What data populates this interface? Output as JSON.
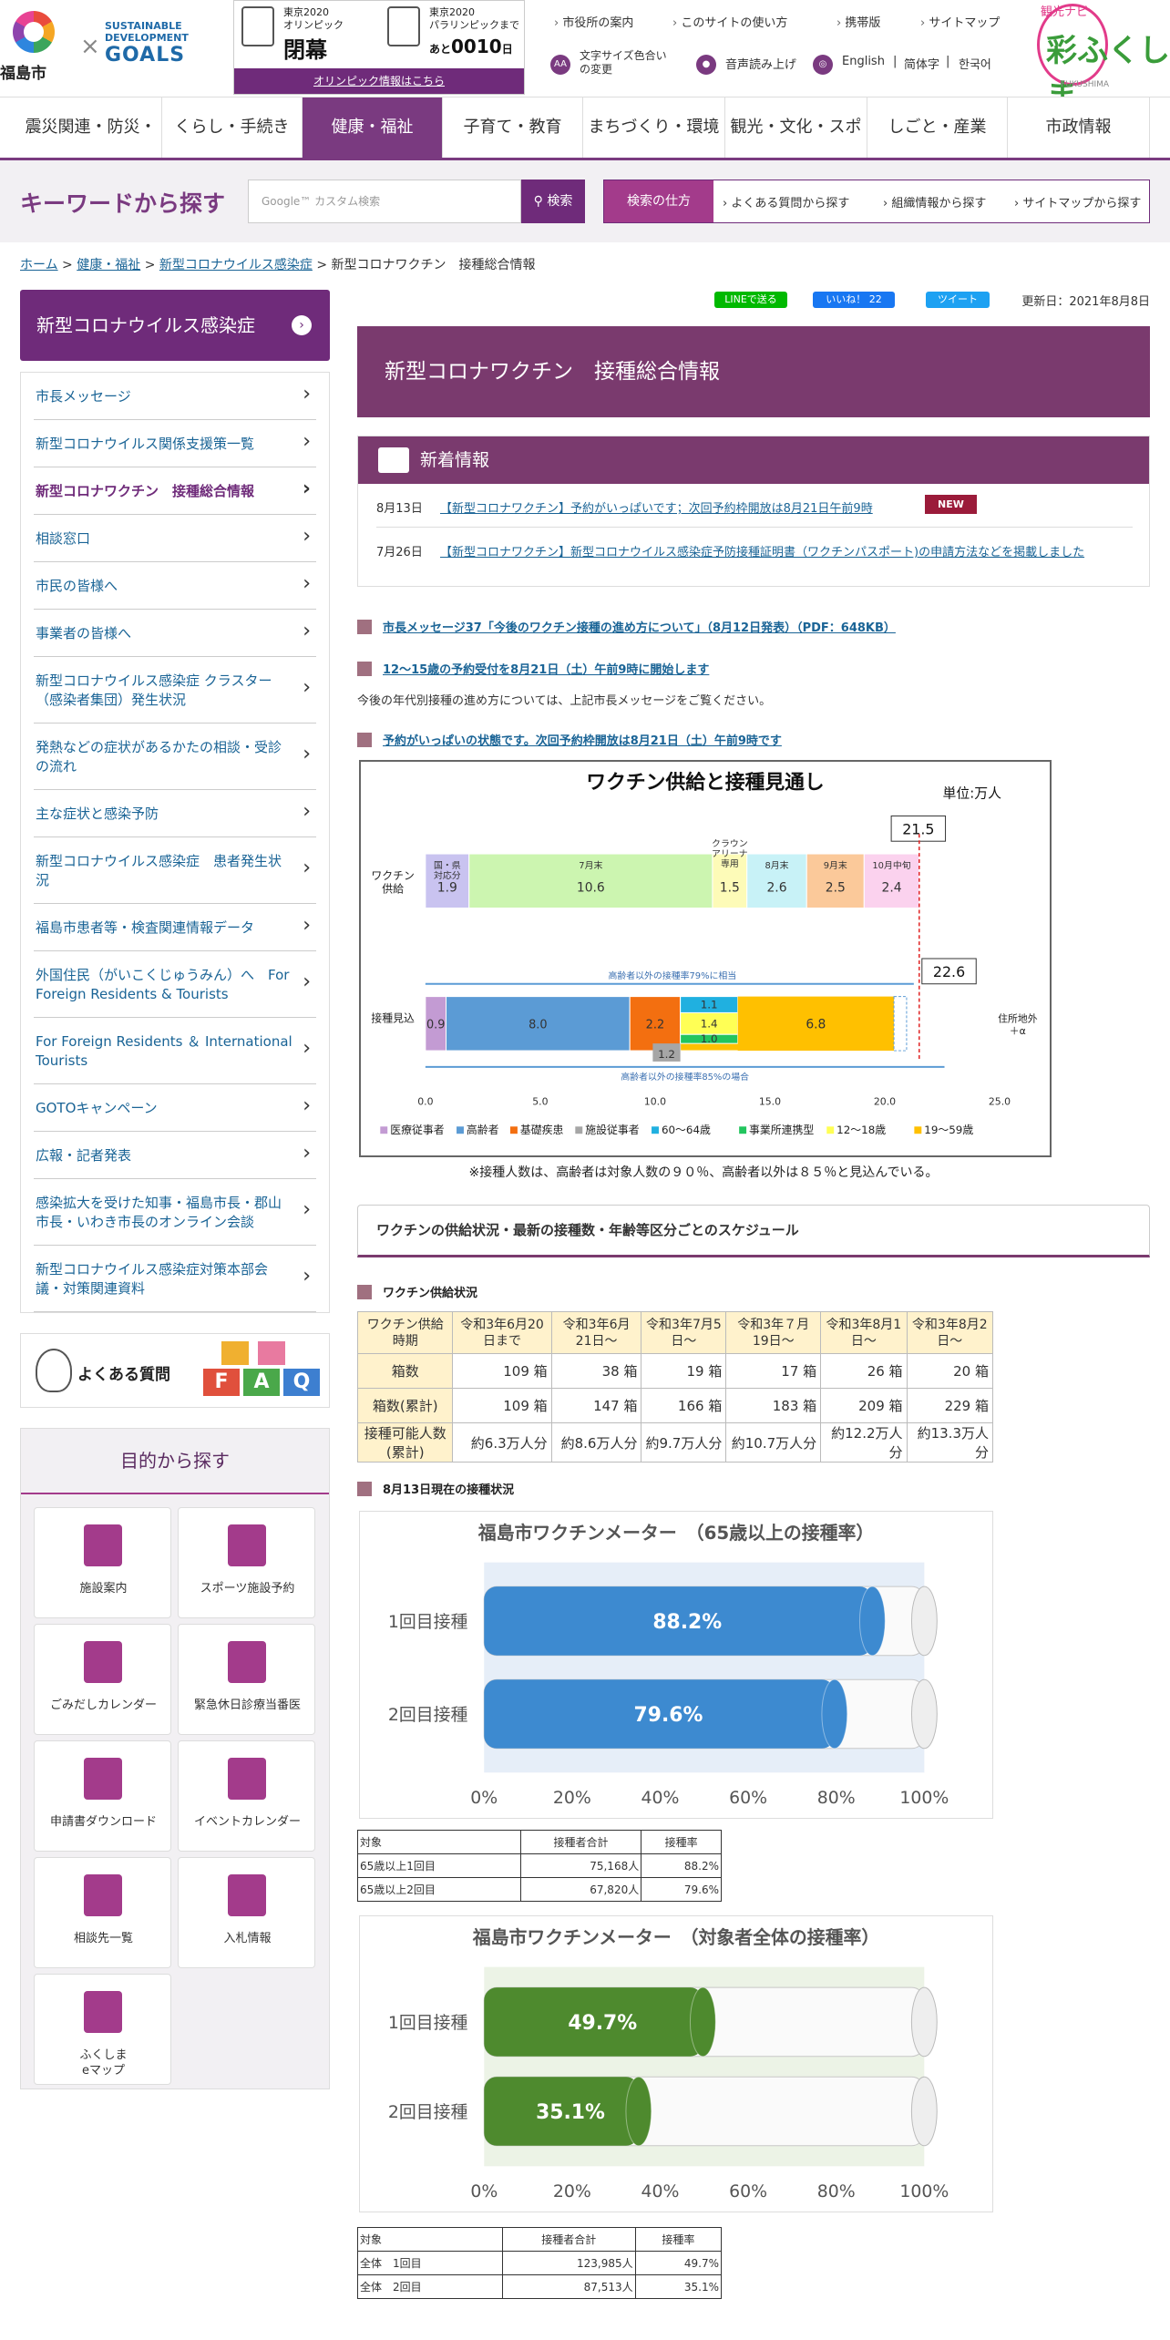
{
  "header": {
    "city_name": "福島市",
    "sdg_line1": "SUSTAINABLE",
    "sdg_line2": "DEVELOPMENT",
    "sdg_line3": "GOALS",
    "olympic": {
      "box1_sub": "東京2020\nオリンピック",
      "box1_big": "閉幕",
      "box2_sub": "東京2020\nパラリンピックまで",
      "box2_prefix": "あと",
      "box2_days": "0010",
      "box2_suffix": "日",
      "link": "オリンピック情報はこちら"
    },
    "util_links": [
      "市役所の案内",
      "このサイトの使い方",
      "携帯版",
      "サイトマップ"
    ],
    "font_color": "文字サイズ色合い\nの変更",
    "read_aloud": "音声読み上げ",
    "langs": [
      "English",
      "简体字",
      "한국어"
    ],
    "kanko_label": "観光ナビ",
    "kanko_logo": "彩ふくしま",
    "kanko_sub": "FUKUSHIMA"
  },
  "gnav": [
    "震災関連・防災・安全",
    "くらし・手続き",
    "健康・福祉",
    "子育て・教育",
    "まちづくり・環境",
    "観光・文化・スポーツ",
    "しごと・産業",
    "市政情報"
  ],
  "search": {
    "title": "キーワードから探す",
    "placeholder": "Google™ カスタム検索",
    "button": "検索",
    "how_label": "検索の仕方",
    "links": [
      "よくある質問から探す",
      "組織情報から探す",
      "サイトマップから探す"
    ]
  },
  "breadcrumb": {
    "items": [
      "ホーム",
      "健康・福祉",
      "新型コロナウイルス感染症"
    ],
    "sep": ">",
    "current": "新型コロナワクチン　接種総合情報"
  },
  "sidebar": {
    "heading": "新型コロナウイルス感染症",
    "items": [
      "市長メッセージ",
      "新型コロナウイルス関係支援策一覧",
      "新型コロナワクチン　接種総合情報",
      "相談窓口",
      "市民の皆様へ",
      "事業者の皆様へ",
      "新型コロナウイルス感染症 クラスター（感染者集団）発生状況",
      "発熱などの症状があるかたの相談・受診の流れ",
      "主な症状と感染予防",
      "新型コロナウイルス感染症　患者発生状況",
      "福島市患者等・検査関連情報データ",
      "外国住民（がいこくじゅうみん）へ　For Foreign Residents & Tourists",
      "For Foreign Residents ＆ International Tourists",
      "GOTOキャンペーン",
      "広報・記者発表",
      "感染拡大を受けた知事・福島市長・郡山市長・いわき市長のオンライン会談",
      "新型コロナウイルス感染症対策本部会議・対策関連資料"
    ],
    "current_index": 2,
    "faq_label": "よくある質問",
    "faq_blocks": [
      "F",
      "A",
      "Q"
    ],
    "purpose_title": "目的から探す",
    "purpose_items": [
      {
        "label": "施設案内",
        "icon": "building-icon"
      },
      {
        "label": "スポーツ施設予約",
        "icon": "sports-icon"
      },
      {
        "label": "ごみだしカレンダー",
        "icon": "trash-icon"
      },
      {
        "label": "緊急休日診療当番医",
        "icon": "doctor-icon"
      },
      {
        "label": "申請書ダウンロード",
        "icon": "clipboard-icon"
      },
      {
        "label": "イベントカレンダー",
        "icon": "event-book-icon"
      },
      {
        "label": "相談先一覧",
        "icon": "consult-icon"
      },
      {
        "label": "入札情報",
        "icon": "bid-person-icon"
      },
      {
        "label": "ふくしま\neマップ",
        "icon": "map-pin-icon"
      }
    ]
  },
  "main": {
    "share": {
      "line": "LINEで送る",
      "like": "いいね！",
      "like_count": "22",
      "tweet": "ツイート"
    },
    "updated": "更新日：2021年8月8日",
    "page_title": "新型コロナワクチン　接種総合情報",
    "news_heading": "新着情報",
    "news": [
      {
        "date": "8月13日",
        "text": "【新型コロナワクチン】予約がいっぱいです；次回予約枠開放は8月21日午前9時",
        "badge": "NEW"
      },
      {
        "date": "7月26日",
        "text": "【新型コロナワクチン】新型コロナウイルス感染症予防接種証明書（ワクチンパスポート)の申請方法などを掲載しました",
        "badge": ""
      }
    ],
    "sec1": "市長メッセージ37「今後のワクチン接種の進め方について」（8月12日発表）（PDF：648KB）",
    "sec2": "12～15歳の予約受付を8月21日（土）午前9時に開始します",
    "sec2_text": "今後の年代別接種の進め方については、上記市長メッセージをご覧ください。",
    "sec3": "予約がいっぱいの状態です。次回予約枠開放は8月21日（土）午前9時です",
    "chart_note": "※接種人数は、高齢者は対象人数の９０％、高齢者以外は８５％と見込んでいる。",
    "schedule_heading": "ワクチンの供給状況・最新の接種数・年齢等区分ごとのスケジュール",
    "supply_heading": "ワクチン供給状況",
    "supply_table": {
      "headers": [
        "ワクチン供給時期",
        "令和3年6月20日まで",
        "令和3年6月21日～",
        "令和3年7月5日～",
        "令和3年７月19日～",
        "令和3年8月1日～",
        "令和3年8月2日～"
      ],
      "rows": [
        [
          "箱数",
          "109 箱",
          "38 箱",
          "19 箱",
          "17 箱",
          "26 箱",
          "20 箱"
        ],
        [
          "箱数(累計)",
          "109 箱",
          "147 箱",
          "166 箱",
          "183 箱",
          "209 箱",
          "229 箱"
        ],
        [
          "接種可能人数(累計)",
          "約6.3万人分",
          "約8.6万人分",
          "約9.7万人分",
          "約10.7万人分",
          "約12.2万人分",
          "約13.3万人分"
        ]
      ]
    },
    "status_heading": "8月13日現在の接種状況",
    "meter65_table": {
      "headers": [
        "対象",
        "接種者合計",
        "接種率"
      ],
      "rows": [
        [
          "65歳以上1回目",
          "75,168人",
          "88.2%"
        ],
        [
          "65歳以上2回目",
          "67,820人",
          "79.6%"
        ]
      ]
    },
    "meterAll_table": {
      "headers": [
        "対象",
        "接種者合計",
        "接種率"
      ],
      "rows": [
        [
          "全体　1回目",
          "123,985人",
          "49.7%"
        ],
        [
          "全体　2回目",
          "87,513人",
          "35.1%"
        ]
      ]
    }
  },
  "chart_data": [
    {
      "type": "bar",
      "title": "ワクチン供給と接種見通し",
      "unit": "単位:万人",
      "x_ticks": [
        "0.0",
        "5.0",
        "10.0",
        "15.0",
        "20.0",
        "25.0"
      ],
      "xlim": [
        0,
        25
      ],
      "rows": [
        {
          "label": "ワクチン\n供給",
          "segments": [
            {
              "name": "国・県\n対応分",
              "value": 1.9,
              "color": "#c9c3f0"
            },
            {
              "name": "7月末",
              "value": 10.6,
              "color": "#ccf5b0"
            },
            {
              "name": "クラウン\nアリーナ\n専用",
              "value": 1.5,
              "color": "#fdfbb8"
            },
            {
              "name": "8月末",
              "value": 2.6,
              "color": "#c8f2f7"
            },
            {
              "name": "9月末",
              "value": 2.5,
              "color": "#fbc99a"
            },
            {
              "name": "10月中旬",
              "value": 2.4,
              "color": "#fbd2ee"
            }
          ],
          "total_label": "21.5"
        },
        {
          "label": "接種見込",
          "segments": [
            {
              "value": 0.9,
              "color": "#c39bd3"
            },
            {
              "value": 8.0,
              "color": "#5b9bd5"
            },
            {
              "value": 2.2,
              "color": "#f36f10"
            },
            {
              "value": 1.1,
              "color": "#20b0e0"
            },
            {
              "value": 1.4,
              "color": "#ffff55"
            },
            {
              "value": 1.0,
              "color": "#22c55e"
            },
            {
              "value": 1.2,
              "color": "#a6a6a6"
            },
            {
              "value": 6.8,
              "color": "#ffc000"
            }
          ],
          "total_label": "22.6"
        }
      ],
      "annotations": [
        "高齢者以外の接種率79%に相当",
        "高齢者以外の接種率85%の場合",
        "住所地外\n＋α"
      ],
      "legend": [
        "医療従事者",
        "高齢者",
        "基礎疾患",
        "施設従事者",
        "60～64歳",
        "事業所連携型",
        "12～18歳",
        "19～59歳"
      ],
      "legend_colors": [
        "#c39bd3",
        "#5b9bd5",
        "#f36f10",
        "#a6a6a6",
        "#20b0e0",
        "#22c55e",
        "#ffff55",
        "#ffc000"
      ]
    },
    {
      "type": "bar",
      "title": "福島市ワクチンメーター　（65歳以上の接種率）",
      "categories": [
        "1回目接種",
        "2回目接種"
      ],
      "values": [
        88.2,
        79.6
      ],
      "value_labels": [
        "88.2%",
        "79.6%"
      ],
      "x_ticks": [
        "0%",
        "20%",
        "40%",
        "60%",
        "80%",
        "100%"
      ],
      "xlim": [
        0,
        100
      ],
      "color": "#3d8ad0"
    },
    {
      "type": "bar",
      "title": "福島市ワクチンメーター　（対象者全体の接種率）",
      "categories": [
        "1回目接種",
        "2回目接種"
      ],
      "values": [
        49.7,
        35.1
      ],
      "value_labels": [
        "49.7%",
        "35.1%"
      ],
      "x_ticks": [
        "0%",
        "20%",
        "40%",
        "60%",
        "80%",
        "100%"
      ],
      "xlim": [
        0,
        100
      ],
      "color": "#4e8a2e"
    }
  ]
}
